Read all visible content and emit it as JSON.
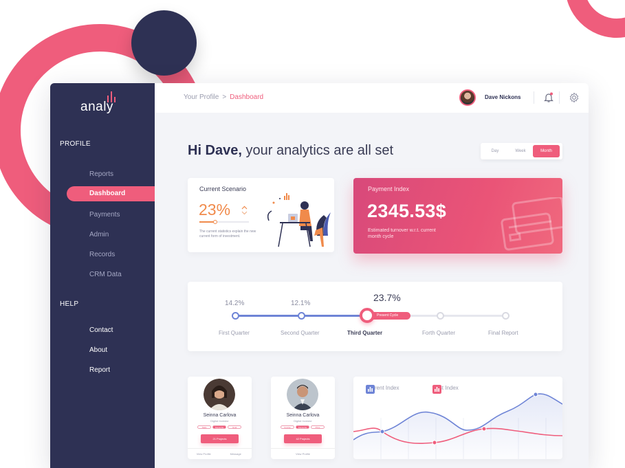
{
  "brand": {
    "logo_text": "analy",
    "accent": "#ef5d7c",
    "navy": "#2e3154",
    "orange": "#f08a4b",
    "blue": "#6e84d6"
  },
  "sidebar": {
    "sections": [
      {
        "title": "PROFILE",
        "items": [
          "Reports",
          "Dashboard",
          "Payments",
          "Admin",
          "Records",
          "CRM Data"
        ],
        "active": "Dashboard"
      },
      {
        "title": "HELP",
        "items": [
          "Contact",
          "About",
          "Report"
        ]
      }
    ]
  },
  "header": {
    "breadcrumb": {
      "parent": "Your Profile",
      "separator": ">",
      "current": "Dashboard"
    },
    "user_name": "Dave Nickons",
    "icons": [
      "avatar",
      "bell-icon",
      "gear-icon"
    ]
  },
  "greeting": {
    "name": "Hi Dave,",
    "rest": " your analytics are all set"
  },
  "period_toggle": {
    "options": [
      "Day",
      "Week",
      "Month"
    ],
    "selected": "Month"
  },
  "scenario_card": {
    "title": "Current Scenario",
    "value": "23%",
    "description": "The current statistics explain the new current form of investment."
  },
  "payment_card": {
    "title": "Payment Index",
    "value": "2345.53$",
    "subtitle": "Estimated turnover w.r.t. current month cycle"
  },
  "timeline": {
    "badge": "Present Cycle",
    "quarters": [
      {
        "label": "First Quarter",
        "value": "14.2%"
      },
      {
        "label": "Second Quarter",
        "value": "12.1%"
      },
      {
        "label": "Third Quarter",
        "value": "23.7%"
      },
      {
        "label": "Forth Quarter",
        "value": ""
      },
      {
        "label": "Final Report",
        "value": ""
      }
    ],
    "current_index": 2
  },
  "profiles": [
    {
      "name": "Seinna Carlova",
      "role": "Digital Investor",
      "chips": [
        "Stats",
        "Favourite",
        "Goal"
      ],
      "chip_on": 1,
      "button": "21 Projects",
      "footer": [
        "View Profile",
        "Message"
      ]
    },
    {
      "name": "Seinna Carlova",
      "role": "Digital Investor",
      "chips": [
        "Course",
        "Favourite",
        "Price"
      ],
      "chip_on": 1,
      "button": "42 Projects",
      "footer": [
        "View Profile"
      ]
    }
  ],
  "index_chart": {
    "legend": [
      {
        "name": "Current Index",
        "color": "#6e84d6"
      },
      {
        "name": "Past Index",
        "color": "#ef5d7c"
      }
    ]
  }
}
